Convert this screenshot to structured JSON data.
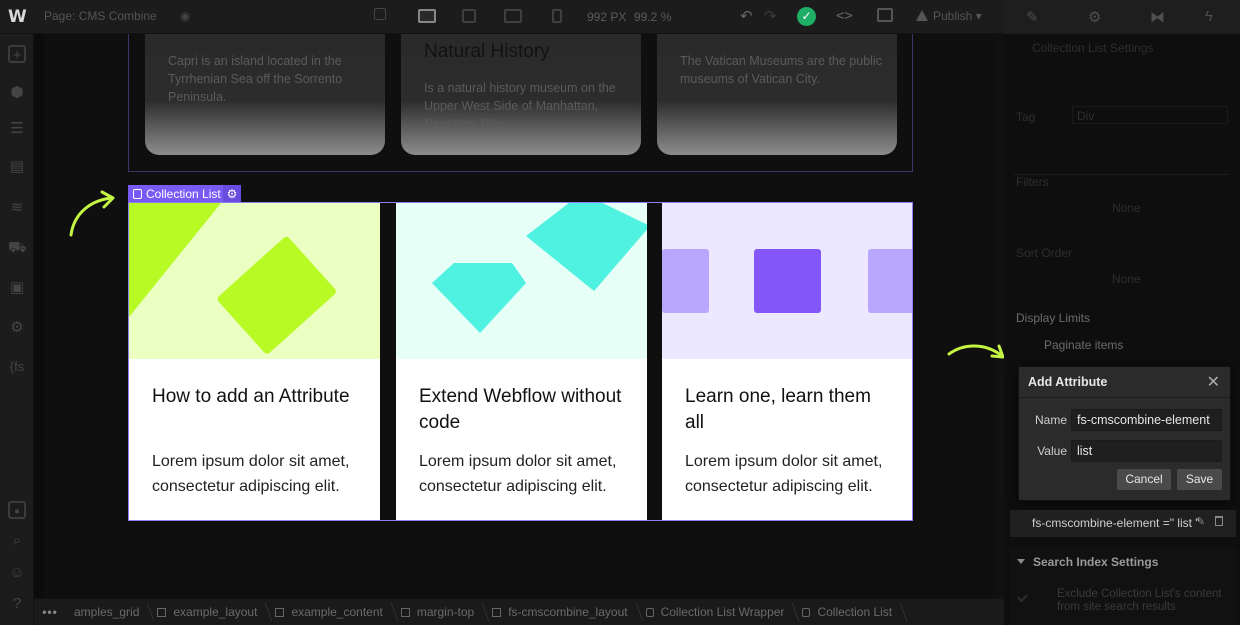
{
  "topbar": {
    "logo": "W",
    "page_prefix": "Page:",
    "page_name": "CMS Combine",
    "canvas_width": "992 PX",
    "zoom": "99.2 %",
    "publish_label": "Publish"
  },
  "canvas": {
    "prev_cards": [
      {
        "title": "",
        "text": "Capri is an island located in the Tyrrhenian Sea off the Sorrento Peninsula."
      },
      {
        "title": "Natural History",
        "text": "Is a natural history museum on the Upper West Side of Manhattan, New York City."
      },
      {
        "title": "",
        "text": "The Vatican Museums are the public museums of Vatican City."
      }
    ],
    "collection_badge": "Collection List",
    "cards": [
      {
        "title": "How to add an Attribute",
        "body": "Lorem ipsum dolor sit amet, consectetur adipiscing elit.",
        "image_bg": "#ecffc2",
        "accent": "#b8fa23"
      },
      {
        "title": "Extend Webflow without code",
        "body": "Lorem ipsum dolor sit amet, consectetur adipiscing elit.",
        "image_bg": "#e6fff7",
        "accent": "#4ff2e0"
      },
      {
        "title": "Learn one, learn them all",
        "body": "Lorem ipsum dolor sit amet, consectetur adipiscing elit.",
        "image_bg": "#ece8ff",
        "accent": "#8b5cf6"
      }
    ]
  },
  "breadcrumb": {
    "more": "•••",
    "items": [
      "amples_grid",
      "example_layout",
      "example_content",
      "margin-top",
      "fs-cmscombine_layout",
      "Collection List Wrapper",
      "Collection List"
    ]
  },
  "right_panel": {
    "section_title": "Collection List Settings",
    "tag_label": "Tag",
    "tag_value": "Div",
    "filters_label": "Filters",
    "filters_value": "None",
    "sort_label": "Sort Order",
    "sort_value": "None",
    "display_limits": "Display Limits",
    "paginate": "Paginate items",
    "dialog": {
      "title": "Add Attribute",
      "name_label": "Name",
      "name_value": "fs-cmscombine-element",
      "value_label": "Value",
      "value_value": "list",
      "cancel": "Cancel",
      "save": "Save"
    },
    "attribute_row": "fs-cmscombine-element =\" list \"",
    "search_index_title": "Search Index Settings",
    "search_index_desc": "Exclude Collection List's content from site search results"
  },
  "colors": {
    "badge": "#7a5af5",
    "arrow": "#c4f542",
    "success": "#1fae65"
  }
}
